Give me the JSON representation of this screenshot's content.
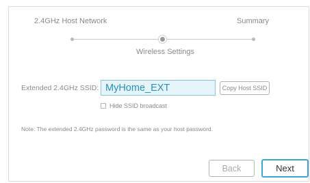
{
  "wizard": {
    "steps": [
      {
        "label": "2.4GHz Host Network"
      },
      {
        "label": "Wireless Settings"
      },
      {
        "label": "Summary"
      }
    ]
  },
  "form": {
    "ssid_label": "Extended 2.4GHz SSID:",
    "ssid_value": "MyHome_EXT",
    "copy_host_ssid_label": "Copy Host SSID",
    "hide_ssid_label": "Hide SSID broadcast",
    "hide_ssid_checked": false,
    "note": "Note: The extended 2.4GHz password is the same as your host password."
  },
  "footer": {
    "back_label": "Back",
    "next_label": "Next"
  },
  "colors": {
    "accent": "#3fa6d3",
    "input_bg": "#e4f4f8",
    "input_text": "#2a8fbd"
  }
}
